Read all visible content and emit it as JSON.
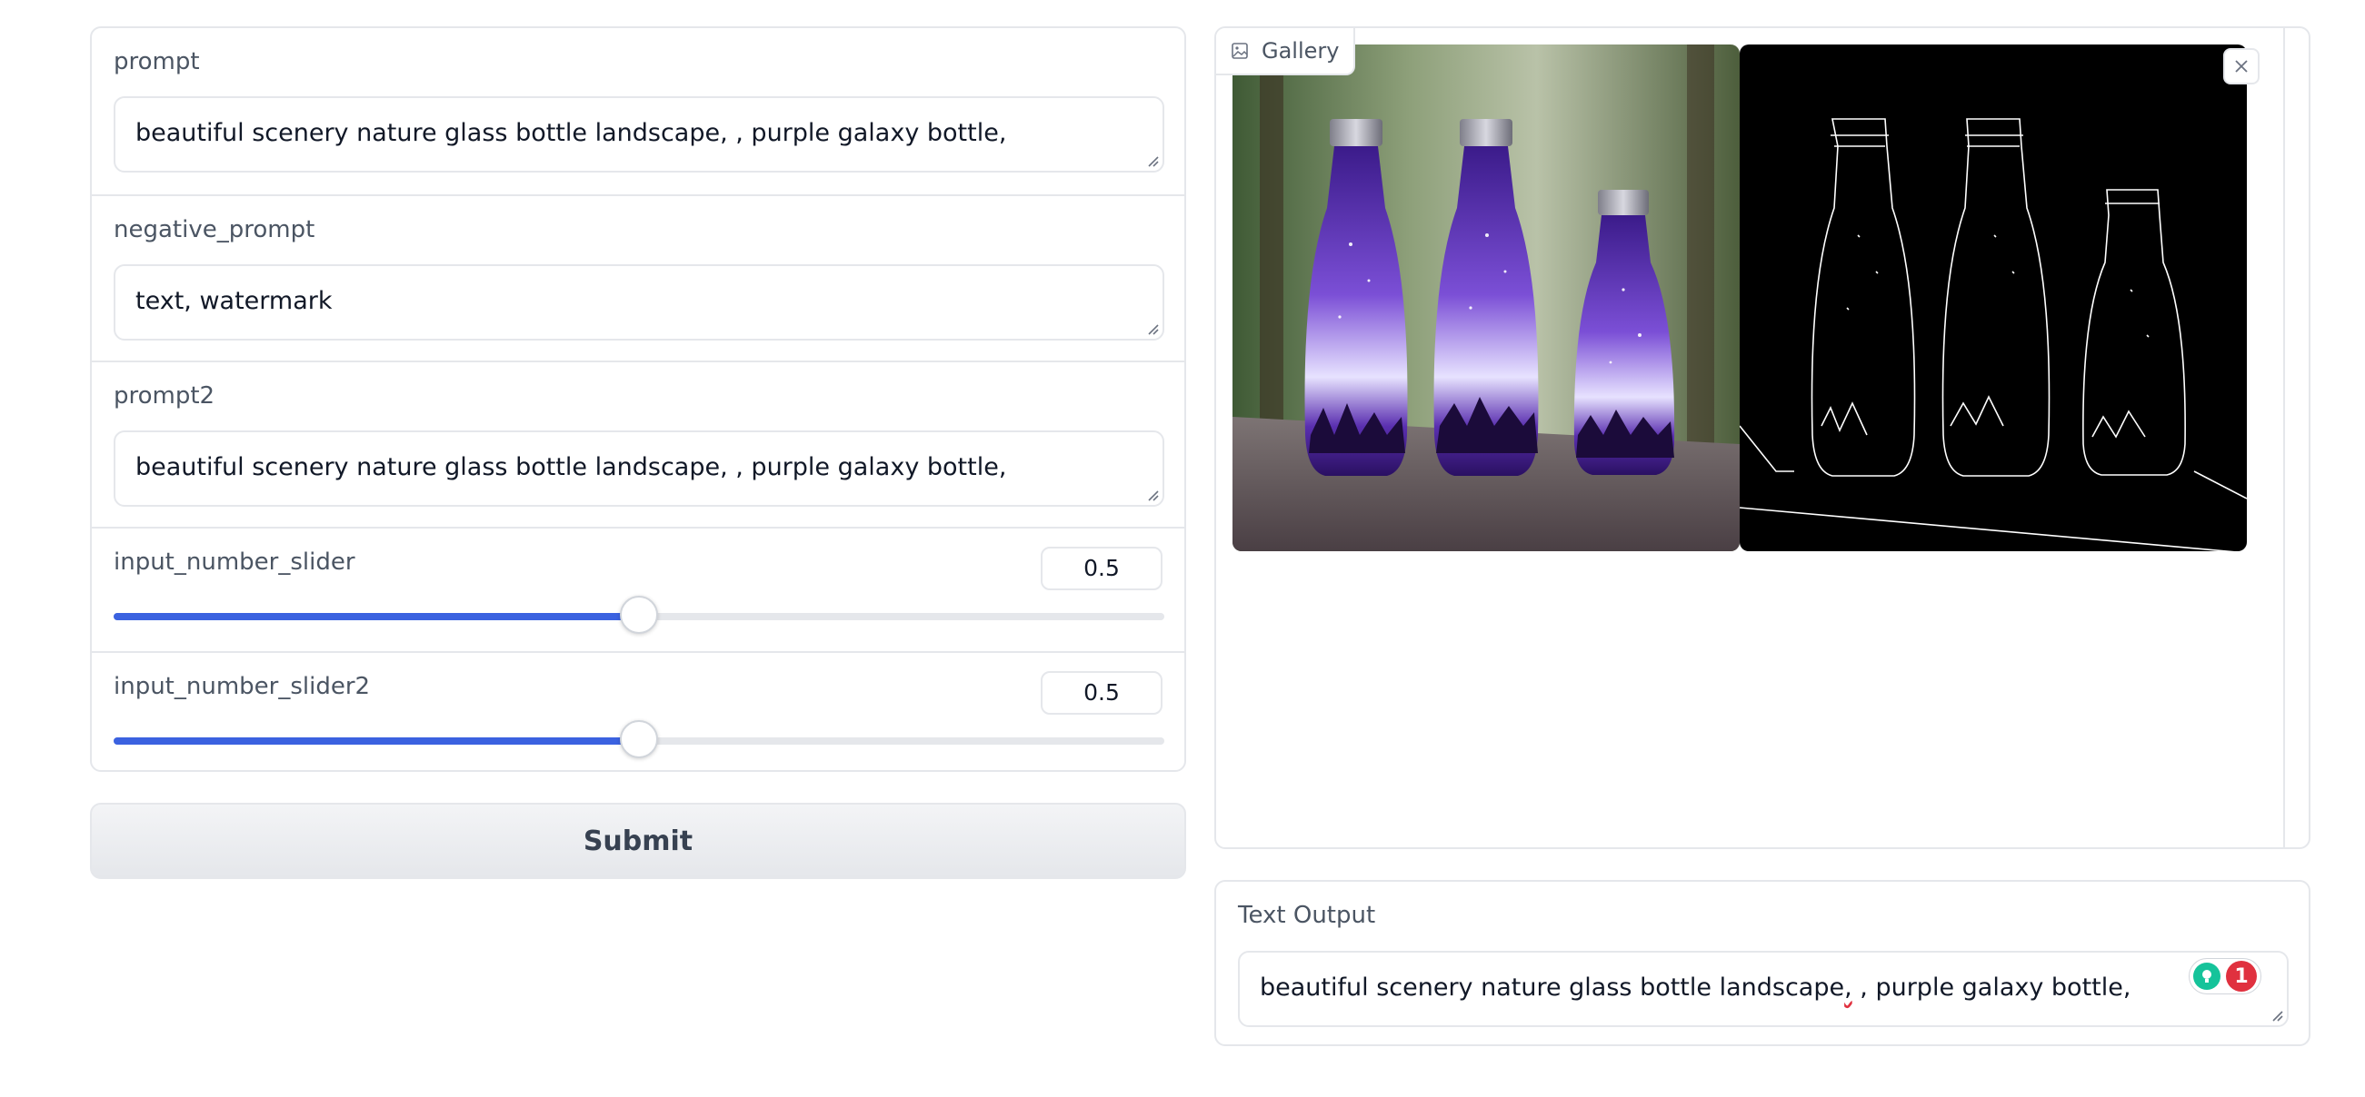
{
  "left": {
    "prompt": {
      "label": "prompt",
      "value": "beautiful scenery nature glass bottle landscape, , purple galaxy bottle,"
    },
    "negative_prompt": {
      "label": "negative_prompt",
      "value": "text, watermark"
    },
    "prompt2": {
      "label": "prompt2",
      "value": "beautiful scenery nature glass bottle landscape, , purple galaxy bottle,"
    },
    "slider1": {
      "label": "input_number_slider",
      "value": "0.5",
      "fraction": 0.5
    },
    "slider2": {
      "label": "input_number_slider2",
      "value": "0.5",
      "fraction": 0.5
    },
    "submit_label": "Submit"
  },
  "gallery": {
    "label": "Gallery",
    "icons": {
      "tag": "image-icon",
      "close": "close-icon"
    }
  },
  "output": {
    "label": "Text Output",
    "value_before": "beautiful scenery nature glass bottle landscape",
    "value_flagged": ",",
    "value_after": " , purple galaxy bottle,",
    "grammar_count": "1"
  },
  "colors": {
    "slider_fill": "#3b62e0",
    "grammar_green": "#15c39a",
    "grammar_red": "#e0313f"
  }
}
